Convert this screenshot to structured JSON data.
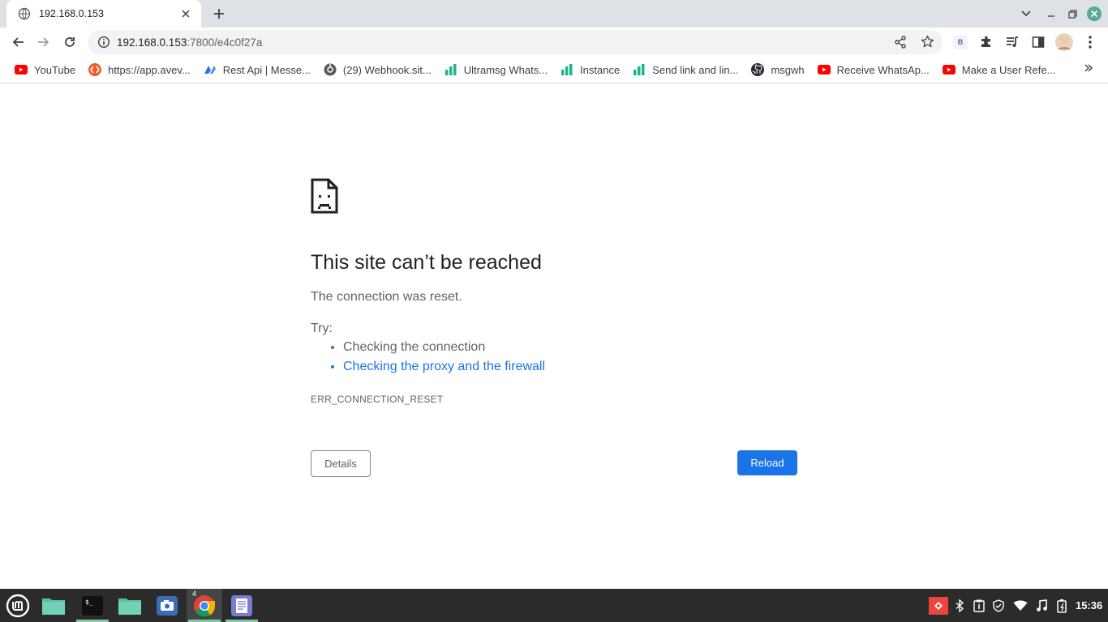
{
  "tab": {
    "title": "192.168.0.153",
    "favicon": "globe-icon"
  },
  "omnibox": {
    "host": "192.168.0.153",
    "path": ":7800/e4c0f27a"
  },
  "bookmarks": [
    {
      "label": "YouTube",
      "icon": "youtube-icon"
    },
    {
      "label": "https://app.avev...",
      "icon": "orange-logo-icon"
    },
    {
      "label": "Rest Api | Messe...",
      "icon": "blue-logo-icon"
    },
    {
      "label": "(29) Webhook.sit...",
      "icon": "webhook-icon"
    },
    {
      "label": "Ultramsg Whats...",
      "icon": "bar-icon"
    },
    {
      "label": "Instance",
      "icon": "bar-icon"
    },
    {
      "label": "Send link and lin...",
      "icon": "bar-icon"
    },
    {
      "label": "msgwh",
      "icon": "github-icon"
    },
    {
      "label": "Receive WhatsAp...",
      "icon": "youtube-icon"
    },
    {
      "label": "Make a User Refe...",
      "icon": "youtube-icon"
    }
  ],
  "error": {
    "title": "This site can’t be reached",
    "message": "The connection was reset.",
    "try_label": "Try:",
    "suggestions": [
      "Checking the connection",
      "Checking the proxy and the firewall"
    ],
    "code": "ERR_CONNECTION_RESET"
  },
  "buttons": {
    "details": "Details",
    "reload": "Reload"
  },
  "extension_badge": "B",
  "taskbar": {
    "chrome_badge": "4",
    "clock": "15:36"
  },
  "colors": {
    "accent": "#1a73e8",
    "taskbar": "#2b2b2b",
    "tabstrip": "#dee1e6"
  }
}
